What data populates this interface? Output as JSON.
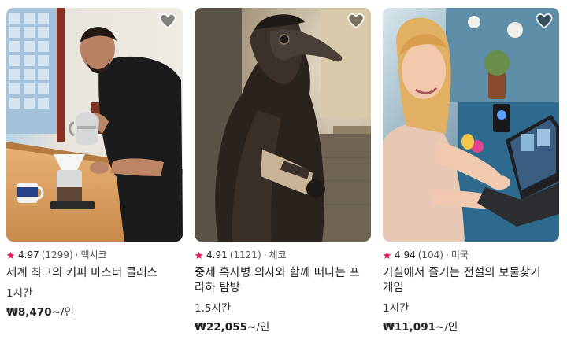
{
  "cards": [
    {
      "rating": "4.97",
      "reviews": "(1299)",
      "separator": "·",
      "country": "멕시코",
      "title": "세계 최고의 커피 마스터 클래스",
      "duration": "1시간",
      "price": "₩8,470~",
      "price_unit": "/인",
      "image_subject": "barista-pouring-coffee-photo"
    },
    {
      "rating": "4.91",
      "reviews": "(1121)",
      "separator": "·",
      "country": "체코",
      "title": "중세 흑사병 의사와 함께 떠나는 프라하 탐방",
      "duration": "1.5시간",
      "price": "₩22,055~",
      "price_unit": "/인",
      "image_subject": "plague-doctor-costume-photo"
    },
    {
      "rating": "4.94",
      "reviews": "(104)",
      "separator": "·",
      "country": "미국",
      "title": "거실에서 즐기는 전설의 보물찾기 게임",
      "duration": "1시간",
      "price": "₩11,091~",
      "price_unit": "/인",
      "image_subject": "woman-at-laptop-photo"
    }
  ],
  "icons": {
    "wishlist": "heart-icon",
    "rating": "star-icon"
  },
  "colors": {
    "star": "#E31C5F",
    "text": "#222222",
    "muted": "#555555"
  }
}
